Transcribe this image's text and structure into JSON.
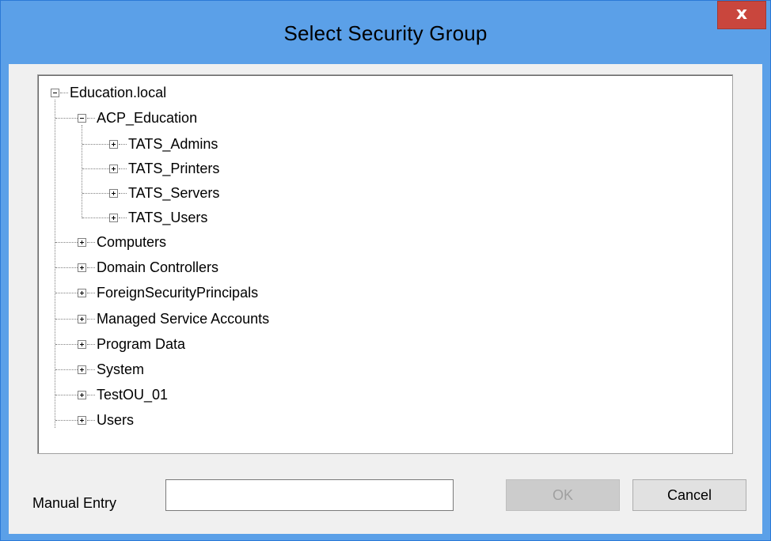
{
  "window": {
    "title": "Select Security Group",
    "close_glyph": "x"
  },
  "tree": {
    "root": {
      "label": "Education.local",
      "state": "expanded"
    },
    "children": [
      {
        "label": "ACP_Education",
        "state": "expanded",
        "children": [
          {
            "label": "TATS_Admins",
            "state": "collapsed"
          },
          {
            "label": "TATS_Printers",
            "state": "collapsed"
          },
          {
            "label": "TATS_Servers",
            "state": "collapsed"
          },
          {
            "label": "TATS_Users",
            "state": "collapsed"
          }
        ]
      },
      {
        "label": "Computers",
        "state": "collapsed"
      },
      {
        "label": "Domain Controllers",
        "state": "collapsed"
      },
      {
        "label": "ForeignSecurityPrincipals",
        "state": "collapsed"
      },
      {
        "label": "Managed Service Accounts",
        "state": "collapsed"
      },
      {
        "label": "Program Data",
        "state": "collapsed"
      },
      {
        "label": "System",
        "state": "collapsed"
      },
      {
        "label": "TestOU_01",
        "state": "collapsed"
      },
      {
        "label": "Users",
        "state": "collapsed"
      }
    ]
  },
  "manual_entry": {
    "label": "Manual Entry",
    "value": "",
    "placeholder": ""
  },
  "buttons": {
    "ok_label": "OK",
    "ok_enabled": false,
    "cancel_label": "Cancel"
  },
  "colors": {
    "titlebar": "#5ba0e8",
    "close_button": "#c9463d",
    "dialog_bg": "#f0f0f0"
  }
}
